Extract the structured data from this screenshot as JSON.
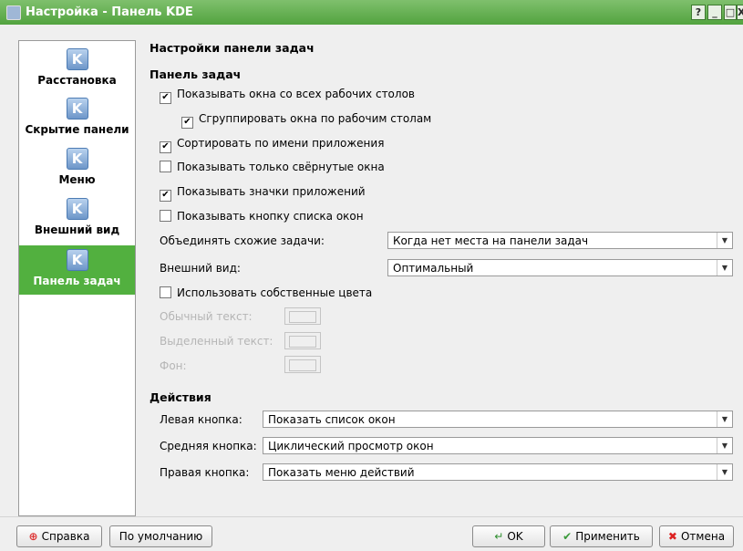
{
  "window": {
    "title": "Настройка - Панель KDE",
    "help_btn": "?",
    "min_btn": "_",
    "max_btn": "□",
    "close_btn": "X"
  },
  "sidebar": {
    "items": [
      {
        "label": "Расстановка",
        "icon": "K"
      },
      {
        "label": "Скрытие панели",
        "icon": "K"
      },
      {
        "label": "Меню",
        "icon": "K"
      },
      {
        "label": "Внешний вид",
        "icon": "K"
      },
      {
        "label": "Панель задач",
        "icon": "K"
      }
    ]
  },
  "page": {
    "title": "Настройки панели задач",
    "taskbar_section": "Панель задач",
    "checkboxes": [
      {
        "label": "Показывать окна со всех рабочих столов",
        "checked": true
      },
      {
        "label": "Сгруппировать окна по рабочим столам",
        "checked": true
      },
      {
        "label": "Сортировать по имени приложения",
        "checked": true
      },
      {
        "label": "Показывать только свёрнутые окна",
        "checked": false
      },
      {
        "label": "Показывать значки приложений",
        "checked": true
      },
      {
        "label": "Показывать кнопку списка окон",
        "checked": false
      }
    ],
    "group_label": "Объединять схожие задачи:",
    "group_value": "Когда нет места на панели задач",
    "appearance_label": "Внешний вид:",
    "appearance_value": "Оптимальный",
    "custom_colors_label": "Использовать собственные цвета",
    "custom_colors_checked": false,
    "normal_text_label": "Обычный текст:",
    "active_text_label": "Выделенный текст:",
    "background_label": "Фон:",
    "actions_section": "Действия",
    "left_button_label": "Левая кнопка:",
    "left_button_value": "Показать список окон",
    "middle_button_label": "Средняя кнопка:",
    "middle_button_value": "Циклический просмотр окон",
    "right_button_label": "Правая кнопка:",
    "right_button_value": "Показать меню действий"
  },
  "buttons": {
    "help": "Справка",
    "defaults": "По умолчанию",
    "ok": "OK",
    "apply": "Применить",
    "cancel": "Отмена"
  },
  "checkmark": "✔",
  "arrow": "▼",
  "colors": {
    "titlebar": "#5aa846",
    "selection": "#52b03f"
  }
}
